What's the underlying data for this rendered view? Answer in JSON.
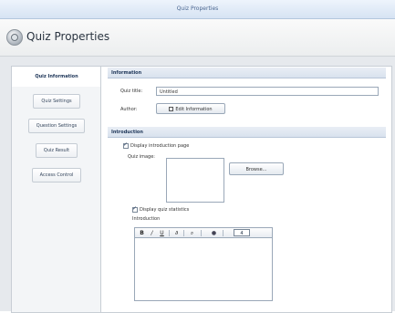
{
  "window": {
    "title": "Quiz Properties"
  },
  "header": {
    "title": "Quiz Properties",
    "icon": "gear-icon"
  },
  "sidebar": {
    "items": [
      {
        "label": "Quiz Information",
        "active": true
      },
      {
        "label": "Quiz Settings",
        "active": false
      },
      {
        "label": "Question Settings",
        "active": false
      },
      {
        "label": "Quiz Result",
        "active": false
      },
      {
        "label": "Access Control",
        "active": false
      }
    ]
  },
  "information": {
    "section_title": "Information",
    "quiz_title_label": "Quiz title:",
    "quiz_title_value": "Untitled",
    "author_label": "Author:",
    "edit_info_button": "Edit Information"
  },
  "introduction": {
    "section_title": "Introduction",
    "display_intro_label": "Display introduction page",
    "display_intro_checked": true,
    "quiz_image_label": "Quiz image:",
    "browse_button": "Browse...",
    "display_stats_label": "Display quiz statistics",
    "display_stats_checked": true,
    "introduction_label": "Introduction",
    "font_size_value": "4"
  },
  "colors": {
    "accent": "#1d3558",
    "border": "#9aa8b8",
    "panel": "#e6e9ed"
  }
}
